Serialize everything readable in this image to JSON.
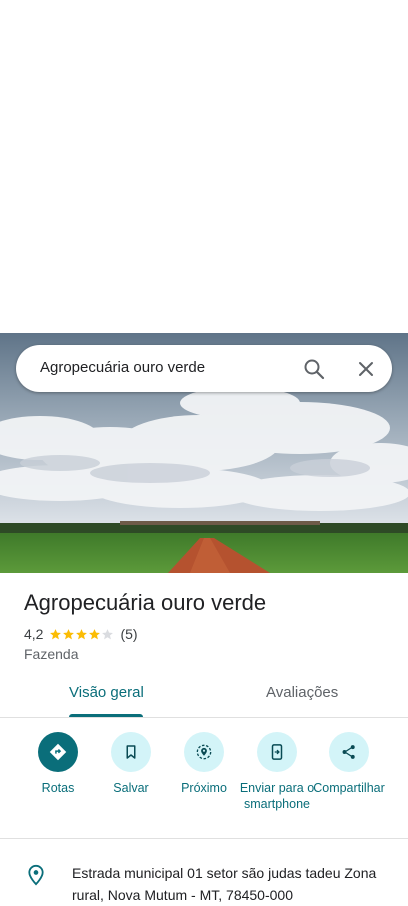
{
  "search": {
    "query": "Agropecuária ouro verde"
  },
  "place": {
    "name": "Agropecuária ouro verde",
    "rating": "4,2",
    "stars": 4.2,
    "review_count": "(5)",
    "category": "Fazenda"
  },
  "tabs": [
    {
      "label": "Visão geral",
      "active": true
    },
    {
      "label": "Avaliações",
      "active": false
    }
  ],
  "actions": [
    {
      "label": "Rotas",
      "icon": "directions-icon"
    },
    {
      "label": "Salvar",
      "icon": "bookmark-icon"
    },
    {
      "label": "Próximo",
      "icon": "nearby-icon"
    },
    {
      "label": "Enviar para o smartphone",
      "icon": "send-to-phone-icon"
    },
    {
      "label": "Compartilhar",
      "icon": "share-icon"
    }
  ],
  "address": {
    "text": "Estrada municipal 01 setor são judas tadeu Zona rural, Nova Mutum - MT, 78450-000",
    "icon": "location-pin-icon"
  },
  "colors": {
    "accent": "#0a6e7a",
    "action_bg": "#d3f4f8",
    "star": "#fbbc04"
  }
}
